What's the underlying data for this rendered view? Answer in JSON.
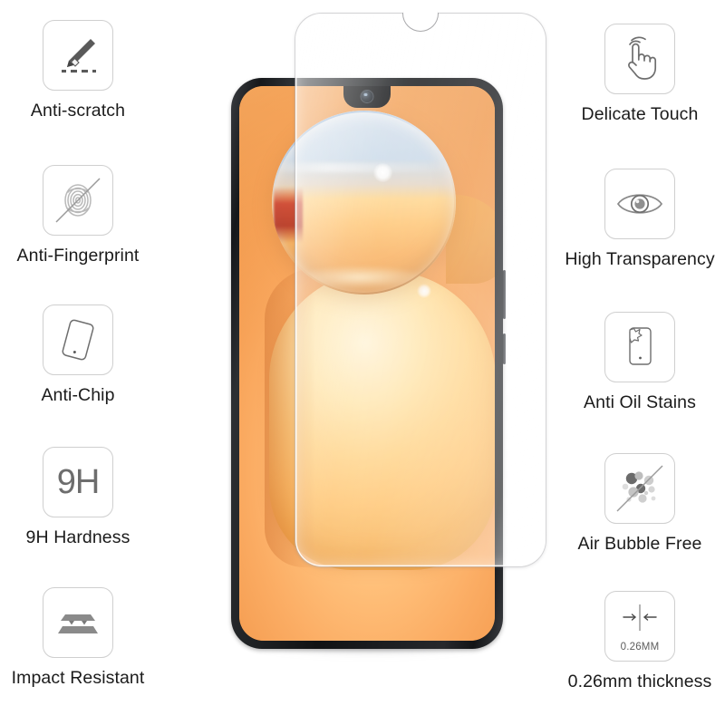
{
  "page": {
    "background_color": "#ffffff",
    "product": "tempered glass screen protector feature infographic"
  },
  "features_left": [
    {
      "label": "Anti-scratch",
      "icon": "pen-scratch-icon"
    },
    {
      "label": "Anti-Fingerprint",
      "icon": "fingerprint-blocked-icon"
    },
    {
      "label": "Anti-Chip",
      "icon": "tilted-glass-panel-icon"
    },
    {
      "label": "9H Hardness",
      "icon": "hardness-9h-icon",
      "icon_text": "9H"
    },
    {
      "label": "Impact Resistant",
      "icon": "stacked-layers-impact-icon"
    }
  ],
  "features_right": [
    {
      "label": "Delicate Touch",
      "icon": "hand-tap-icon"
    },
    {
      "label": "High Transparency",
      "icon": "eye-icon"
    },
    {
      "label": "Anti Oil Stains",
      "icon": "phone-oil-stain-icon"
    },
    {
      "label": "Air Bubble Free",
      "icon": "bubbles-blocked-icon"
    },
    {
      "label": "0.26mm thickness",
      "icon": "thickness-arrows-icon",
      "icon_text": "0.26MM"
    }
  ],
  "phone": {
    "name": "smartphone-mockup",
    "notch": "waterdrop-notch",
    "camera": "front-camera",
    "wallpaper": "orange-gradient-sphere-wallpaper",
    "body_color": "#16181b",
    "screen_accent": "#f2974a"
  },
  "glass_overlay": {
    "name": "tempered-glass-sheet",
    "notch_cutout": "camera-notch-cutout"
  },
  "colors": {
    "text": "#1b1b1b",
    "icon_stroke": "#5a5a5a",
    "icon_border": "#cfcfcf",
    "accent_orange": "#f2974a"
  }
}
